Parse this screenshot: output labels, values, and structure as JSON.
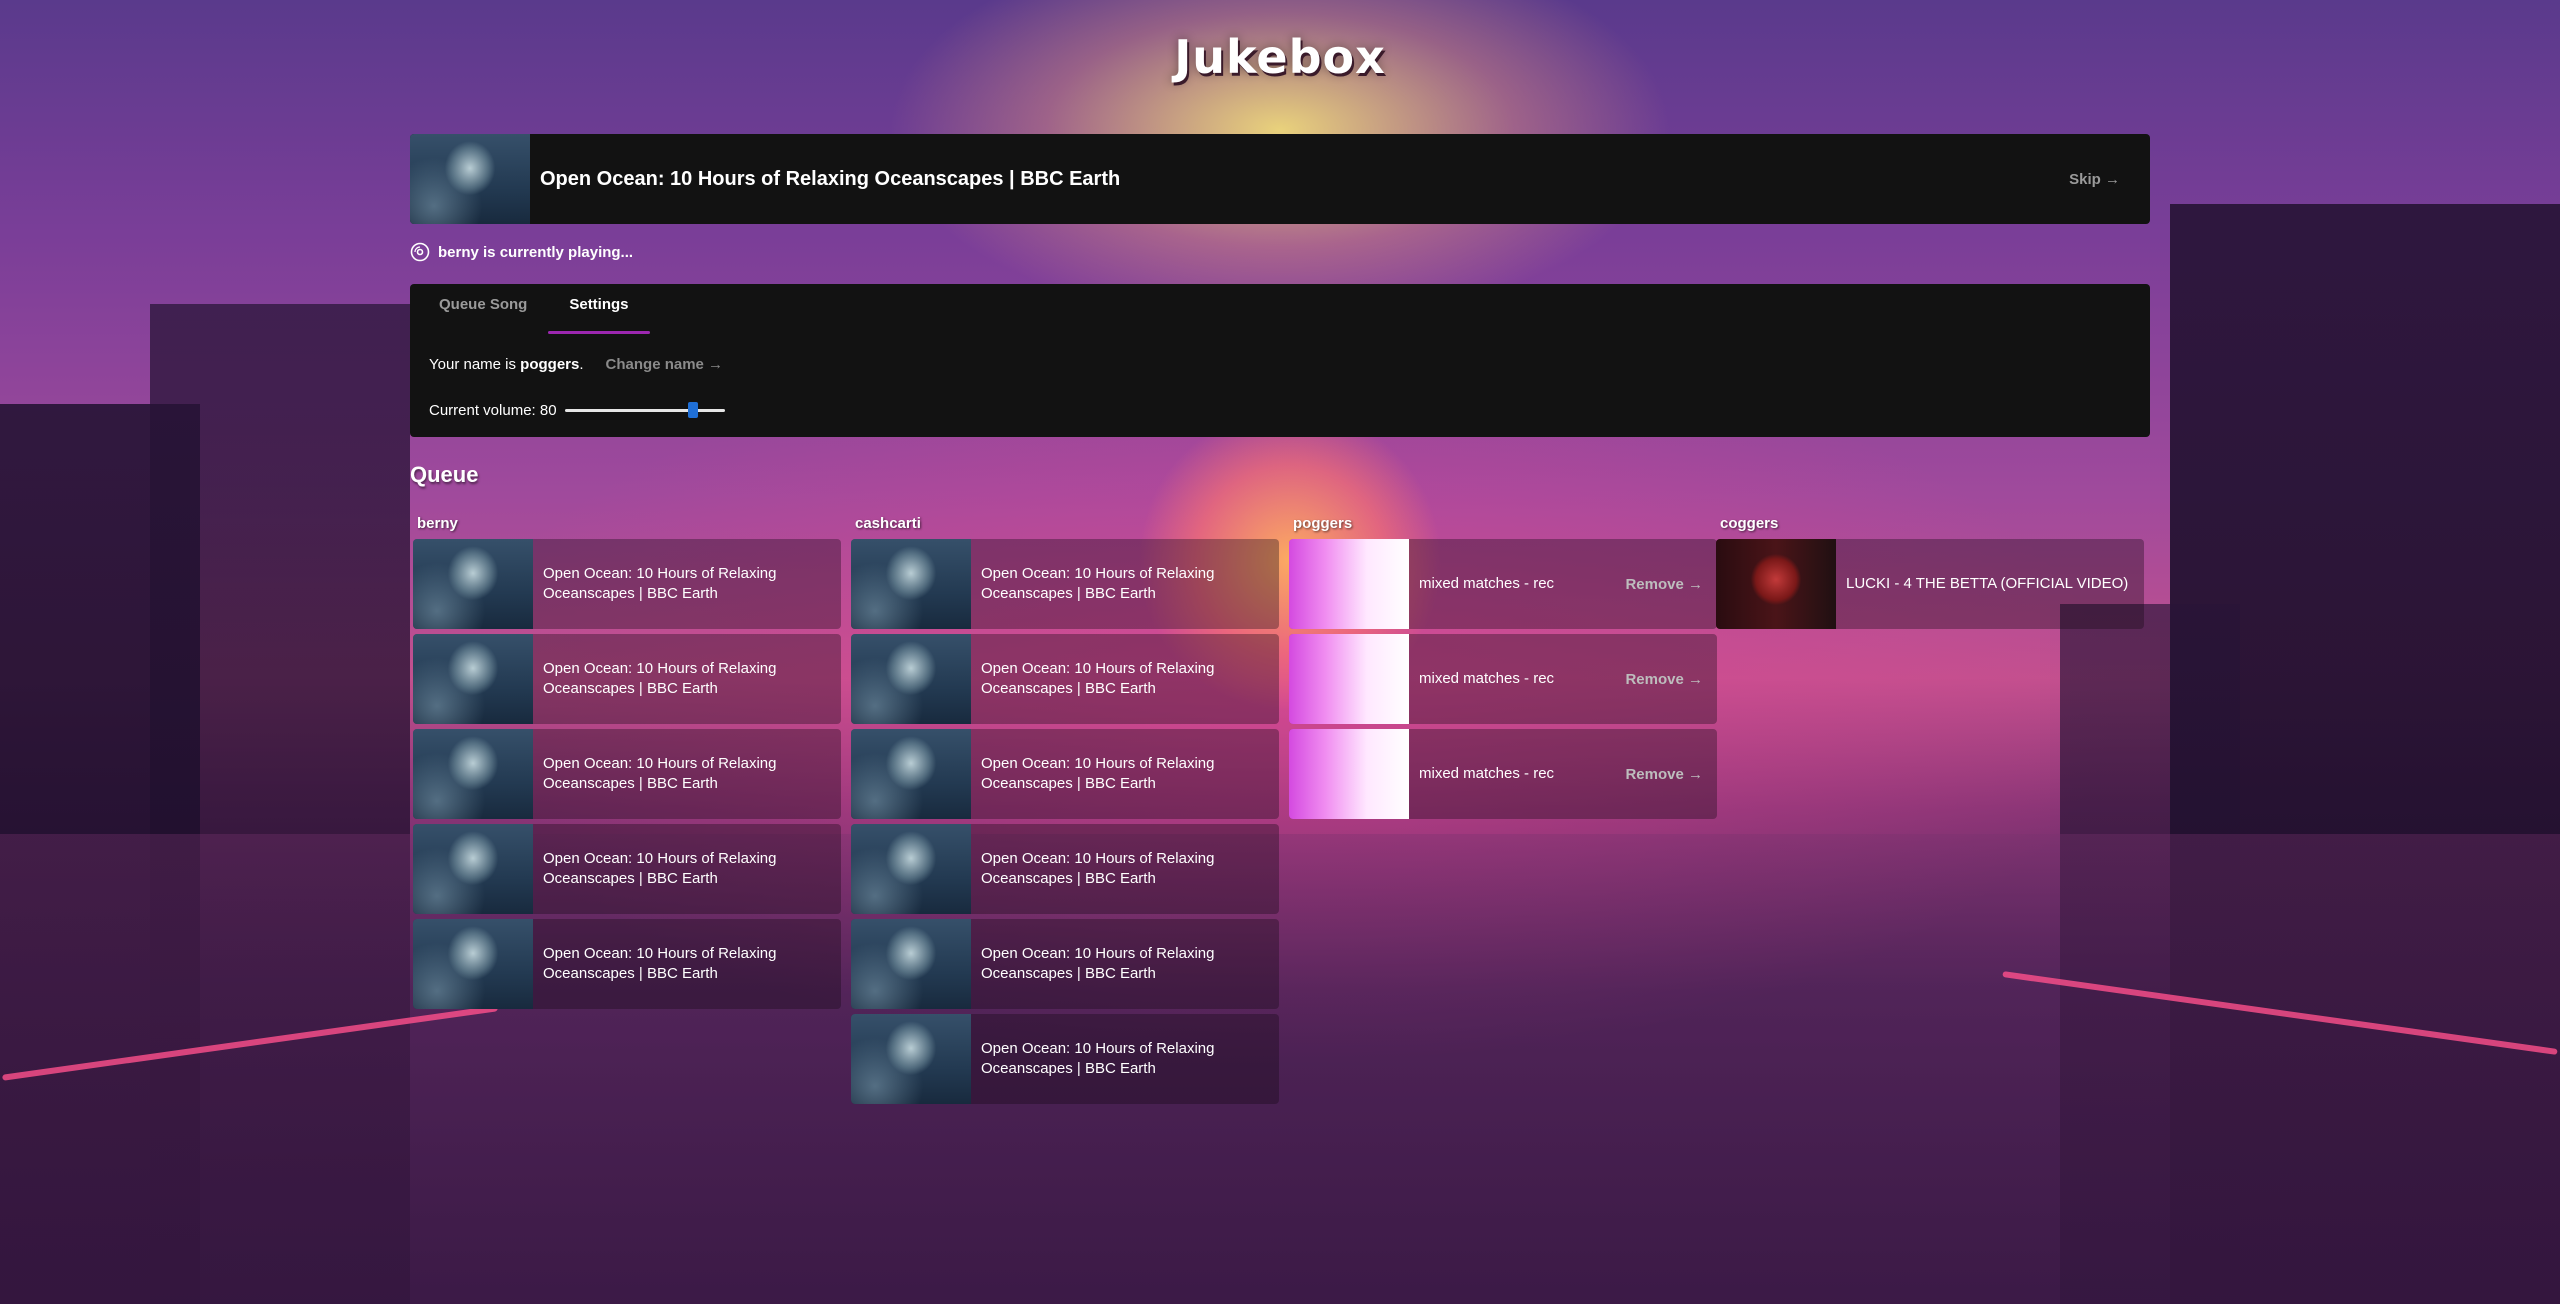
{
  "app": {
    "title": "Jukebox"
  },
  "now_playing": {
    "title": "Open Ocean: 10 Hours of Relaxing Oceanscapes | BBC Earth",
    "skip_label": "Skip →"
  },
  "status": {
    "text": "berny is currently playing..."
  },
  "tabs": [
    {
      "label": "Queue Song",
      "active": false
    },
    {
      "label": "Settings",
      "active": true
    }
  ],
  "settings": {
    "name_prefix": "Your name is ",
    "name": "poggers",
    "name_suffix": ".",
    "change_name_label": "Change name →",
    "volume_label": "Current volume: 80",
    "volume": 80
  },
  "queue": {
    "heading": "Queue",
    "columns": [
      {
        "user": "berny",
        "items": [
          {
            "title": "Open Ocean: 10 Hours of Relaxing Oceanscapes | BBC Earth",
            "thumb": "ocean"
          },
          {
            "title": "Open Ocean: 10 Hours of Relaxing Oceanscapes | BBC Earth",
            "thumb": "ocean"
          },
          {
            "title": "Open Ocean: 10 Hours of Relaxing Oceanscapes | BBC Earth",
            "thumb": "ocean"
          },
          {
            "title": "Open Ocean: 10 Hours of Relaxing Oceanscapes | BBC Earth",
            "thumb": "ocean"
          },
          {
            "title": "Open Ocean: 10 Hours of Relaxing Oceanscapes | BBC Earth",
            "thumb": "ocean"
          }
        ]
      },
      {
        "user": "cashcarti",
        "items": [
          {
            "title": "Open Ocean: 10 Hours of Relaxing Oceanscapes | BBC Earth",
            "thumb": "ocean"
          },
          {
            "title": "Open Ocean: 10 Hours of Relaxing Oceanscapes | BBC Earth",
            "thumb": "ocean"
          },
          {
            "title": "Open Ocean: 10 Hours of Relaxing Oceanscapes | BBC Earth",
            "thumb": "ocean"
          },
          {
            "title": "Open Ocean: 10 Hours of Relaxing Oceanscapes | BBC Earth",
            "thumb": "ocean"
          },
          {
            "title": "Open Ocean: 10 Hours of Relaxing Oceanscapes | BBC Earth",
            "thumb": "ocean"
          },
          {
            "title": "Open Ocean: 10 Hours of Relaxing Oceanscapes | BBC Earth",
            "thumb": "ocean"
          }
        ]
      },
      {
        "user": "poggers",
        "items": [
          {
            "title": "mixed matches - rec",
            "thumb": "mixed",
            "remove_label": "Remove →"
          },
          {
            "title": "mixed matches - rec",
            "thumb": "mixed",
            "remove_label": "Remove →"
          },
          {
            "title": "mixed matches - rec",
            "thumb": "mixed",
            "remove_label": "Remove →"
          }
        ]
      },
      {
        "user": "coggers",
        "items": [
          {
            "title": "LUCKI - 4 THE BETTA (OFFICIAL VIDEO)",
            "thumb": "lucki"
          }
        ]
      }
    ]
  },
  "colors": {
    "panel_bg": "#121212",
    "tab_accent": "#9c27b0",
    "slider_thumb": "#1f6fd6"
  }
}
